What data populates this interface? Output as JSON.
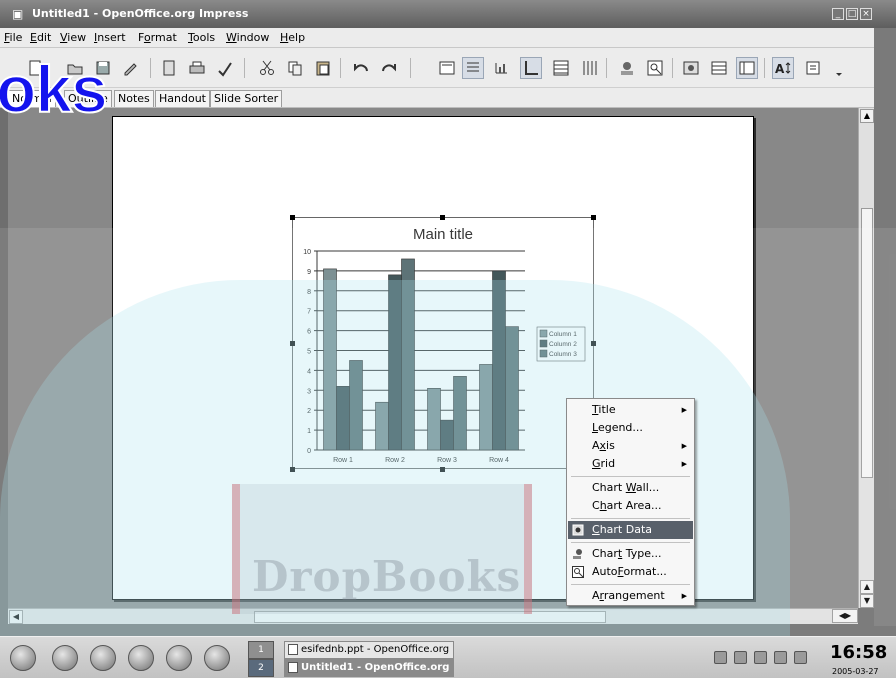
{
  "window": {
    "title": "Untitled1 - OpenOffice.org Impress"
  },
  "menubar": {
    "items": [
      {
        "pre": "",
        "u": "F",
        "post": "ile"
      },
      {
        "pre": "",
        "u": "E",
        "post": "dit"
      },
      {
        "pre": "",
        "u": "V",
        "post": "iew"
      },
      {
        "pre": "",
        "u": "I",
        "post": "nsert"
      },
      {
        "pre": "F",
        "u": "o",
        "post": "rmat"
      },
      {
        "pre": "",
        "u": "T",
        "post": "ools"
      },
      {
        "pre": "",
        "u": "W",
        "post": "indow"
      },
      {
        "pre": "",
        "u": "H",
        "post": "elp"
      }
    ]
  },
  "tabs": {
    "items": [
      "Normal",
      "Outline",
      "Notes",
      "Handout",
      "Slide Sorter"
    ],
    "active": "Normal"
  },
  "chart_data": {
    "type": "bar",
    "title": "Main title",
    "categories": [
      "Row 1",
      "Row 2",
      "Row 3",
      "Row 4"
    ],
    "series": [
      {
        "name": "Column 1",
        "values": [
          9.1,
          2.4,
          3.1,
          4.3
        ],
        "color": "#6f8487"
      },
      {
        "name": "Column 2",
        "values": [
          3.2,
          8.8,
          1.5,
          9.0
        ],
        "color": "#2e4448"
      },
      {
        "name": "Column 3",
        "values": [
          4.5,
          9.6,
          3.7,
          6.2
        ],
        "color": "#4b6468"
      }
    ],
    "ylim": [
      0,
      10
    ],
    "yticks": [
      0,
      1,
      2,
      3,
      4,
      5,
      6,
      7,
      8,
      9,
      10
    ],
    "grid": true,
    "legend": "right"
  },
  "context_menu": {
    "items": [
      {
        "pre": "",
        "u": "T",
        "post": "itle",
        "sub": true
      },
      {
        "pre": "",
        "u": "L",
        "post": "egend...",
        "sub": false
      },
      {
        "pre": "A",
        "u": "x",
        "post": "is",
        "sub": true
      },
      {
        "pre": "",
        "u": "G",
        "post": "rid",
        "sub": true
      },
      {
        "pre": "Chart ",
        "u": "W",
        "post": "all...",
        "sub": false
      },
      {
        "pre": "C",
        "u": "h",
        "post": "art Area...",
        "sub": false
      },
      {
        "pre": "",
        "u": "C",
        "post": "hart Data",
        "sub": false
      },
      {
        "pre": "Char",
        "u": "t",
        "post": " Type...",
        "sub": false
      },
      {
        "pre": "Auto",
        "u": "F",
        "post": "ormat...",
        "sub": false
      },
      {
        "pre": "A",
        "u": "r",
        "post": "rangement",
        "sub": true
      }
    ],
    "highlighted": "Chart Data"
  },
  "watermark": {
    "text_top": "oks",
    "text_center": "DropBooks"
  },
  "taskbar": {
    "pager": [
      "1",
      "2"
    ],
    "tasks": [
      {
        "label": "esifednb.ppt - OpenOffice.org",
        "active": false
      },
      {
        "label": "Untitled1 - OpenOffice.org",
        "active": true
      }
    ]
  },
  "clock": {
    "time": "16:58",
    "date": "2005-03-27"
  }
}
